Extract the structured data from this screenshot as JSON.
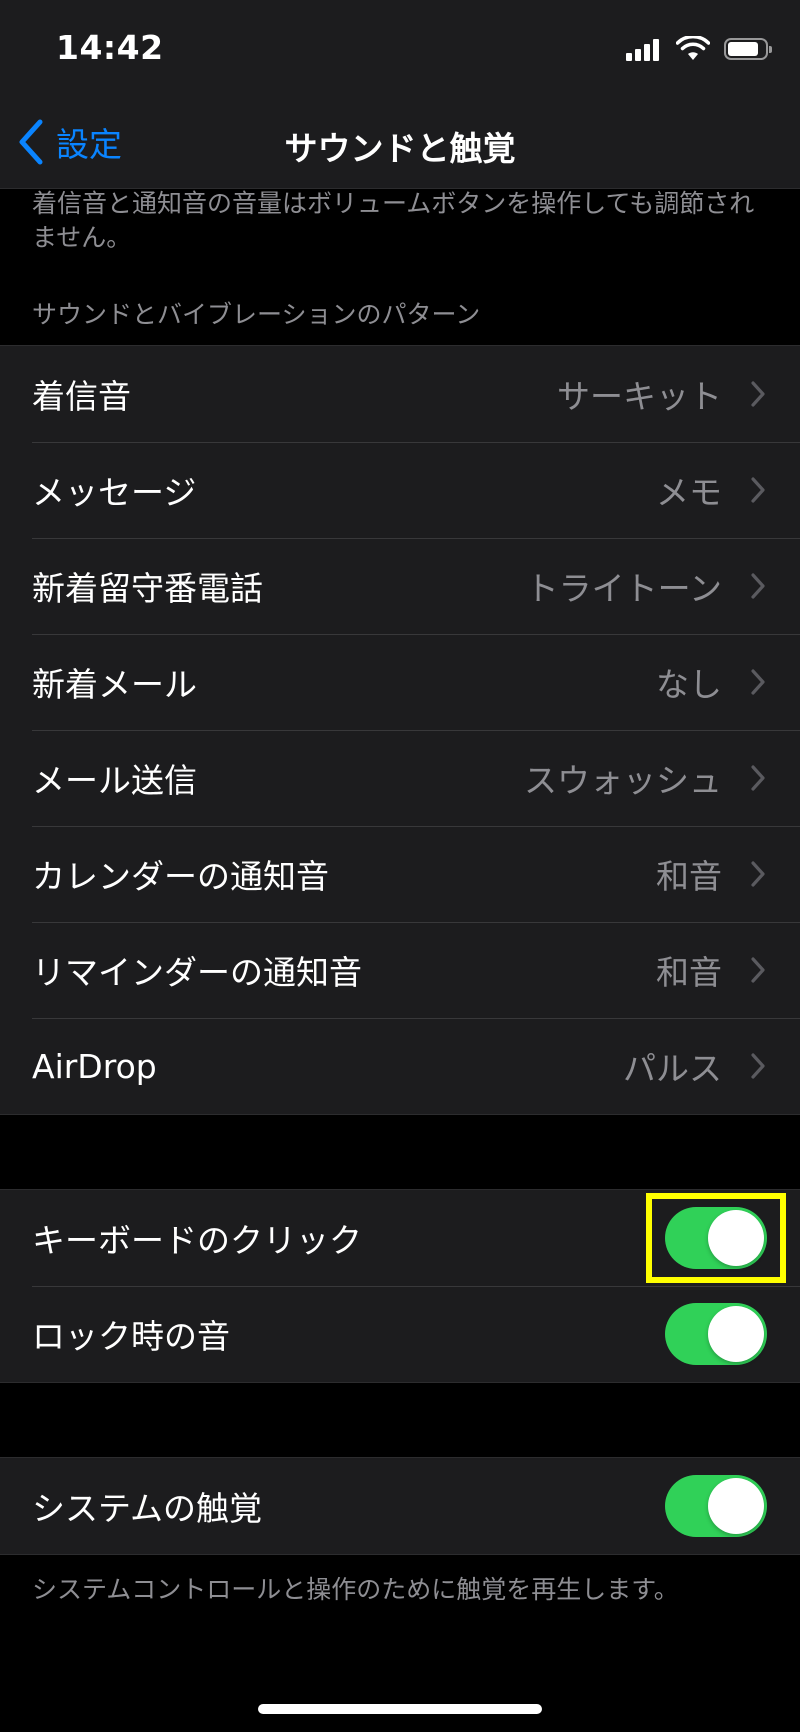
{
  "status_bar": {
    "time": "14:42",
    "icons": [
      "cellular-signal-icon",
      "wifi-icon",
      "battery-icon"
    ]
  },
  "nav": {
    "back_label": "設定",
    "title": "サウンドと触覚"
  },
  "top_note": "着信音と通知音の音量はボリュームボタンを操作しても調節されません。",
  "sound_section": {
    "header": "サウンドとバイブレーションのパターン",
    "items": [
      {
        "label": "着信音",
        "value": "サーキット"
      },
      {
        "label": "メッセージ",
        "value": "メモ"
      },
      {
        "label": "新着留守番電話",
        "value": "トライトーン"
      },
      {
        "label": "新着メール",
        "value": "なし"
      },
      {
        "label": "メール送信",
        "value": "スウォッシュ"
      },
      {
        "label": "カレンダーの通知音",
        "value": "和音"
      },
      {
        "label": "リマインダーの通知音",
        "value": "和音"
      },
      {
        "label": "AirDrop",
        "value": "パルス"
      }
    ]
  },
  "toggles_section": {
    "items": [
      {
        "label": "キーボードのクリック",
        "on": true,
        "highlighted": true
      },
      {
        "label": "ロック時の音",
        "on": true
      }
    ]
  },
  "haptics_section": {
    "items": [
      {
        "label": "システムの触覚",
        "on": true
      }
    ],
    "footer": "システムコントロールと操作のために触覚を再生します。"
  },
  "colors": {
    "accent": "#0a84ff",
    "toggle_on": "#30d158",
    "highlight": "#ffff00",
    "background": "#000000",
    "cell": "#1c1c1e"
  }
}
